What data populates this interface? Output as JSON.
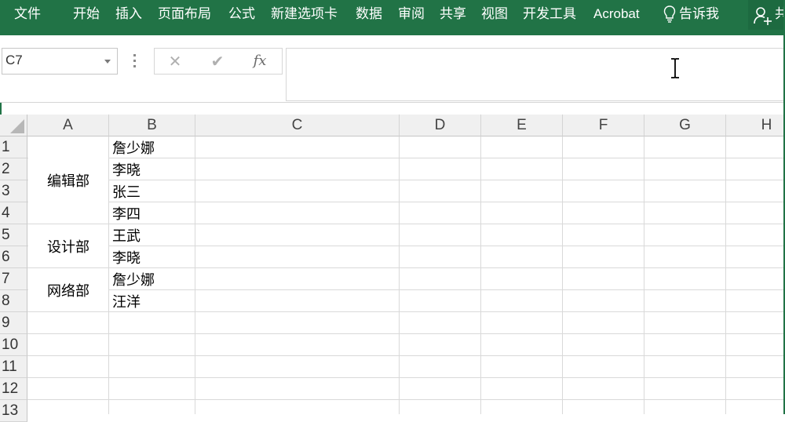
{
  "ribbon": {
    "tabs": [
      "文件",
      "开始",
      "插入",
      "页面布局",
      "公式",
      "新建选项卡",
      "数据",
      "审阅",
      "共享",
      "视图",
      "开发工具",
      "Acrobat"
    ],
    "tell_me": "告诉我",
    "share_label": "共"
  },
  "formula_bar": {
    "name_box": "C7",
    "cancel_icon": "✕",
    "enter_icon": "✔",
    "fx_label": "fx",
    "content": ""
  },
  "grid": {
    "columns": [
      "A",
      "B",
      "C",
      "D",
      "E",
      "F",
      "G",
      "H"
    ],
    "rows": [
      "1",
      "2",
      "3",
      "4",
      "5",
      "6",
      "7",
      "8",
      "9",
      "10",
      "11",
      "12",
      "13"
    ],
    "merged_a": [
      {
        "rows": "1-4",
        "text": "编辑部"
      },
      {
        "rows": "5-6",
        "text": "设计部"
      },
      {
        "rows": "7-8",
        "text": "网络部"
      }
    ],
    "col_b": [
      "詹少娜",
      "李晓",
      "张三",
      "李四",
      "王武",
      "李晓",
      "詹少娜",
      "汪洋"
    ]
  },
  "colors": {
    "ribbon": "#217346",
    "header_bg": "#f0f0f0",
    "gridline": "#d9d9d9"
  }
}
